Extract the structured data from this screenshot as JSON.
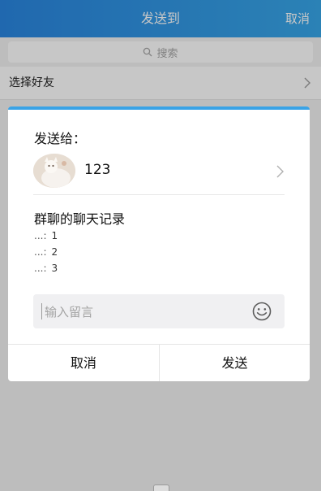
{
  "header": {
    "title": "发送到",
    "cancel_label": "取消"
  },
  "search": {
    "placeholder": "搜索",
    "icon": "search-icon"
  },
  "friends_row": {
    "label": "选择好友",
    "icon": "chevron-right-icon"
  },
  "dialog": {
    "send_to_label": "发送给：",
    "recipient": {
      "name": "123",
      "avatar": "avatar"
    },
    "history": {
      "title": "群聊的聊天记录",
      "messages": [
        {
          "sender": "...:",
          "text": "1"
        },
        {
          "sender": "...:",
          "text": "2"
        },
        {
          "sender": "...:",
          "text": "3"
        }
      ]
    },
    "comment": {
      "value": "",
      "placeholder": "输入留言",
      "icon": "emoji-icon"
    },
    "buttons": {
      "cancel": "取消",
      "send": "发送"
    }
  },
  "colors": {
    "header_gradient_start": "#2a86e0",
    "header_gradient_end": "#38a7e9",
    "dialog_accent": "#3aa3e6"
  }
}
